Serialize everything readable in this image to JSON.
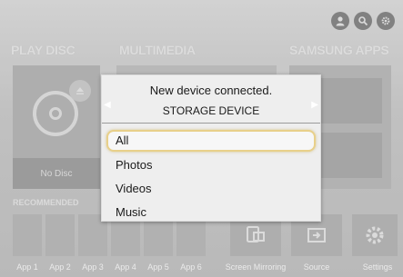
{
  "sections": {
    "play_disc": "PLAY DISC",
    "multimedia": "MULTIMEDIA",
    "samsung_apps": "SAMSUNG APPS",
    "recommended": "RECOMMENDED"
  },
  "play_disc_panel": {
    "status": "No Disc"
  },
  "top_icons": [
    "user-icon",
    "search-icon",
    "settings-icon"
  ],
  "bottom_apps": [
    "App 1",
    "App 2",
    "App 3",
    "App 4",
    "App 5",
    "App 6"
  ],
  "bottom_tiles": {
    "screen_mirroring": "Screen Mirroring",
    "source": "Source",
    "settings": "Settings"
  },
  "popup": {
    "message": "New device connected.",
    "device": "STORAGE DEVICE",
    "options": [
      "All",
      "Photos",
      "Videos",
      "Music"
    ],
    "selected": "All"
  },
  "colors": {
    "focus_border": "#e8d08a",
    "popup_bg": "#eeeeee"
  }
}
